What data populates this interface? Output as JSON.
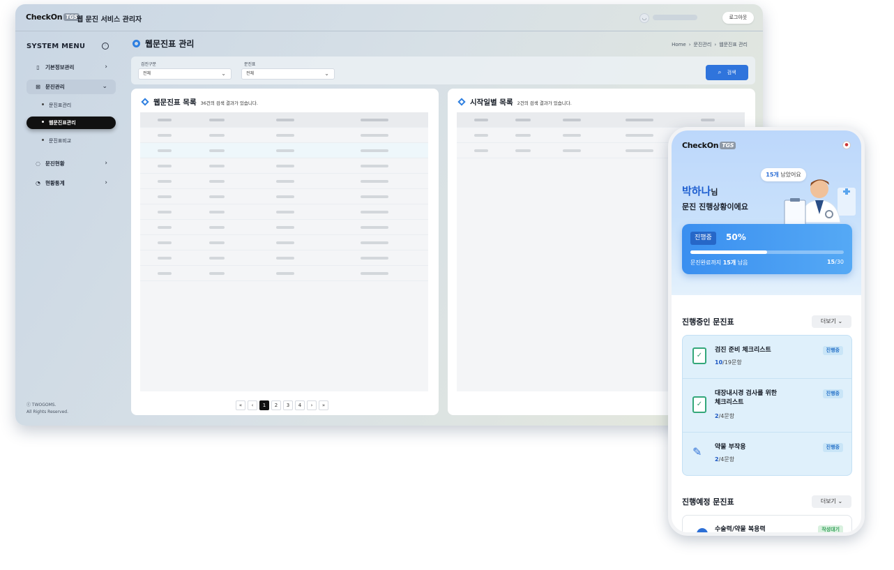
{
  "desktop": {
    "logo": "CheckOn",
    "logo_badge": "TGS",
    "app_title": "웹 문진 서비스 관리자",
    "logout_label": "로그아웃",
    "sidebar": {
      "title": "SYSTEM MENU",
      "items": [
        {
          "label": "기본정보관리",
          "icon": "clipboard-icon"
        },
        {
          "label": "문진관리",
          "icon": "grid-icon"
        },
        {
          "label": "문진현황",
          "icon": "loading-icon"
        },
        {
          "label": "현황통계",
          "icon": "pie-chart-icon"
        }
      ],
      "sub_items": [
        "문진표관리",
        "웹문진표관리",
        "문진표비교"
      ],
      "copyright_line1": "ⓒ TWOGOMS.",
      "copyright_line2": "All Rights Reserved."
    },
    "page_title": "웹문진표 관리",
    "breadcrumb": [
      "Home",
      "문진관리",
      "웹문진표 관리"
    ],
    "filter": {
      "label1": "검진구분",
      "value1": "전체",
      "label2": "문진표",
      "value2": "전체",
      "search_label": "검색"
    },
    "left_panel": {
      "title": "웹문진표 목록",
      "count": "36건의 검색 결과가 있습니다.",
      "pages": [
        "1",
        "2",
        "3",
        "4"
      ],
      "current_page": "1"
    },
    "right_panel": {
      "title": "시작일별 목록",
      "count": "2건의 검색 결과가 있습니다."
    }
  },
  "mobile": {
    "logo": "CheckOn",
    "logo_badge": "TGS",
    "bubble_count": "15개",
    "bubble_rest": " 남았어요",
    "greeting_name": "박하나",
    "greeting_suffix": "님",
    "greeting_line2": "문진 진행상황이에요",
    "progress": {
      "badge": "진행중",
      "percent": "50%",
      "fill": 0.5,
      "remaining_prefix": "문진완료까지 ",
      "remaining_count": "15개",
      "remaining_suffix": " 남음",
      "done": "15",
      "total": "/30"
    },
    "section1_title": "진행중인 문진표",
    "section2_title": "진행예정 문진표",
    "more_label": "더보기",
    "cards": [
      {
        "title": "검진 준비 체크리스트",
        "done": "10",
        "total": "/19문항",
        "tag": "진행중"
      },
      {
        "title": "대장내시경 검사를 위한",
        "title2": "체크리스트",
        "done": "2",
        "total": "/4문항",
        "tag": "진행중"
      },
      {
        "title": "약물 부작용",
        "done": "2",
        "total": "/4문항",
        "tag": "진행중"
      }
    ],
    "upcoming": [
      {
        "title": "수술력/약물 복용력",
        "tag": "작성대기"
      }
    ]
  }
}
